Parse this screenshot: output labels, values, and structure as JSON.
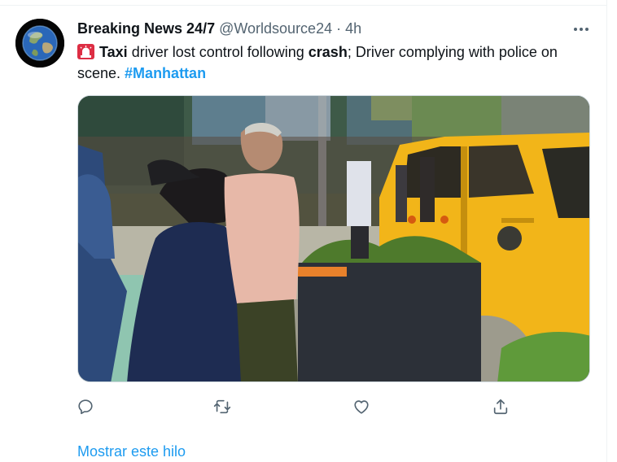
{
  "tweet": {
    "author_name": "Breaking News 24/7",
    "handle": "@Worldsource24",
    "separator": "·",
    "time": "4h",
    "text_parts": {
      "taxi": "Taxi",
      "part1": " driver lost control following ",
      "crash": "crash",
      "part2": "; Driver complying with police on scene. ",
      "hashtag": "#Manhattan"
    },
    "emoji_icon": "police-siren-icon"
  },
  "actions": [
    {
      "name": "reply",
      "icon": "speech-bubble-icon"
    },
    {
      "name": "retweet",
      "icon": "retweet-arrows-icon"
    },
    {
      "name": "like",
      "icon": "heart-icon"
    },
    {
      "name": "share",
      "icon": "upload-share-icon"
    }
  ],
  "footer": {
    "show_thread": "Mostrar este hilo"
  },
  "colors": {
    "accent": "#1d9bf0",
    "secondary_text": "#536471",
    "taxi_yellow": "#f2b519"
  }
}
